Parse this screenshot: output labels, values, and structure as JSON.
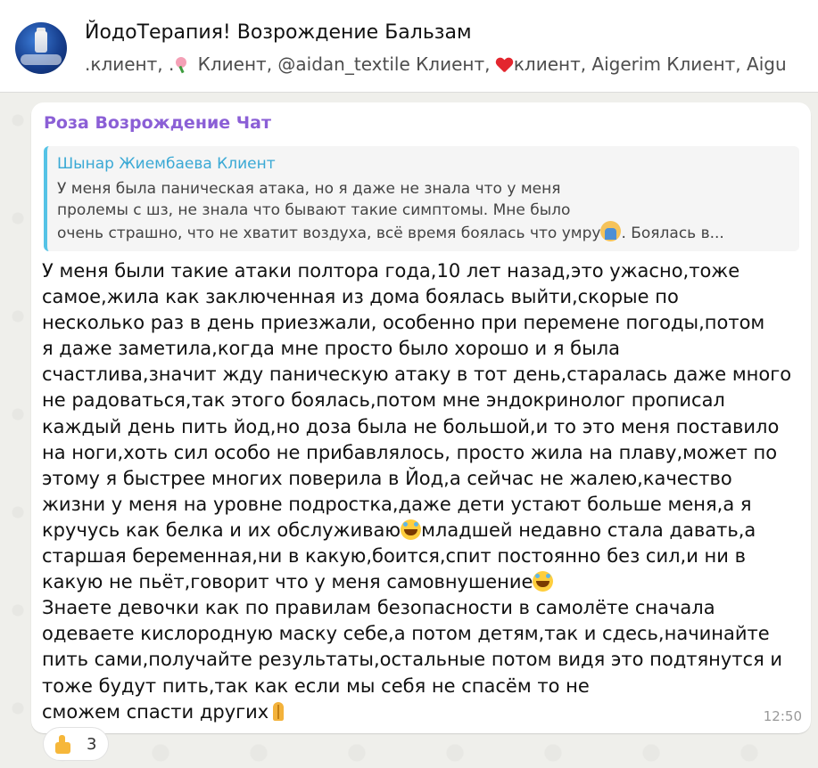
{
  "header": {
    "title": "ЙодоТерапия! Возрождение Бальзам",
    "members": [
      ".клиент, .",
      " Клиент, @aidan_textile Клиент, ",
      "клиент, Aigerim Клиент, Aigu"
    ]
  },
  "message": {
    "sender": "Роза Возрождение Чат",
    "quote": {
      "author": "Шынар Жиембаева Клиент",
      "text_lines": [
        "У меня была паническая атака, но я даже не знала что у меня",
        "пролемы с шз, не знала что бывают такие симптомы. Мне было",
        "очень страшно, что не хватит воздуха, всё время боялась что умру",
        ". Боялась в..."
      ]
    },
    "body": {
      "part1": "У меня были такие атаки полтора года,10 лет назад,это ужасно,тоже\nсамое,жила как заключенная из дома боялась выйти,скорые по\nнесколько раз в день приезжали, особенно при перемене погоды,потом\nя даже заметила,когда мне просто было хорошо и я была\nсчастлива,значит жду паническую атаку в тот день,старалась даже много\nне радоваться,так этого боялась,потом мне эндокринолог прописал\nкаждый день пить йод,но доза была не большой,и то это меня поставило\nна ноги,хоть сил особо не прибавлялось, просто жила на плаву,может по\nэтому я быстрее многих поверила в Йод,а сейчас не жалею,качество\nжизни у меня на уровне подростка,даже дети устают больше меня,а я\nкручусь как белка и их обслуживаю",
      "part2": "младшей недавно стала давать,а\nстаршая беременная,ни в какую,боится,спит постоянно без сил,и ни в\nкакую не пьёт,говорит что у меня самовнушение",
      "part3": "\nЗнаете девочки как по правилам безопасности в самолёте сначала\nодеваете кислородную маску себе,а потом детям,так и сдесь,начинайте\nпить сами,получайте результаты,остальные потом видя это подтянутся и\nтоже будут пить,так как если  мы себя не спасём то не\nсможем спасти других"
    },
    "time": "12:50"
  },
  "reaction": {
    "count": "3"
  },
  "icons": {
    "flower": "flower-emoji",
    "heart": "heart-emoji",
    "laugh": "laughing-emoji",
    "pray": "praying-hands-emoji",
    "person": "person-emoji",
    "thumb": "thumbs-up-emoji"
  },
  "colors": {
    "sender": "#8b5fd6",
    "quote_author": "#3aa9d5",
    "quote_bar": "#55c3e6"
  }
}
